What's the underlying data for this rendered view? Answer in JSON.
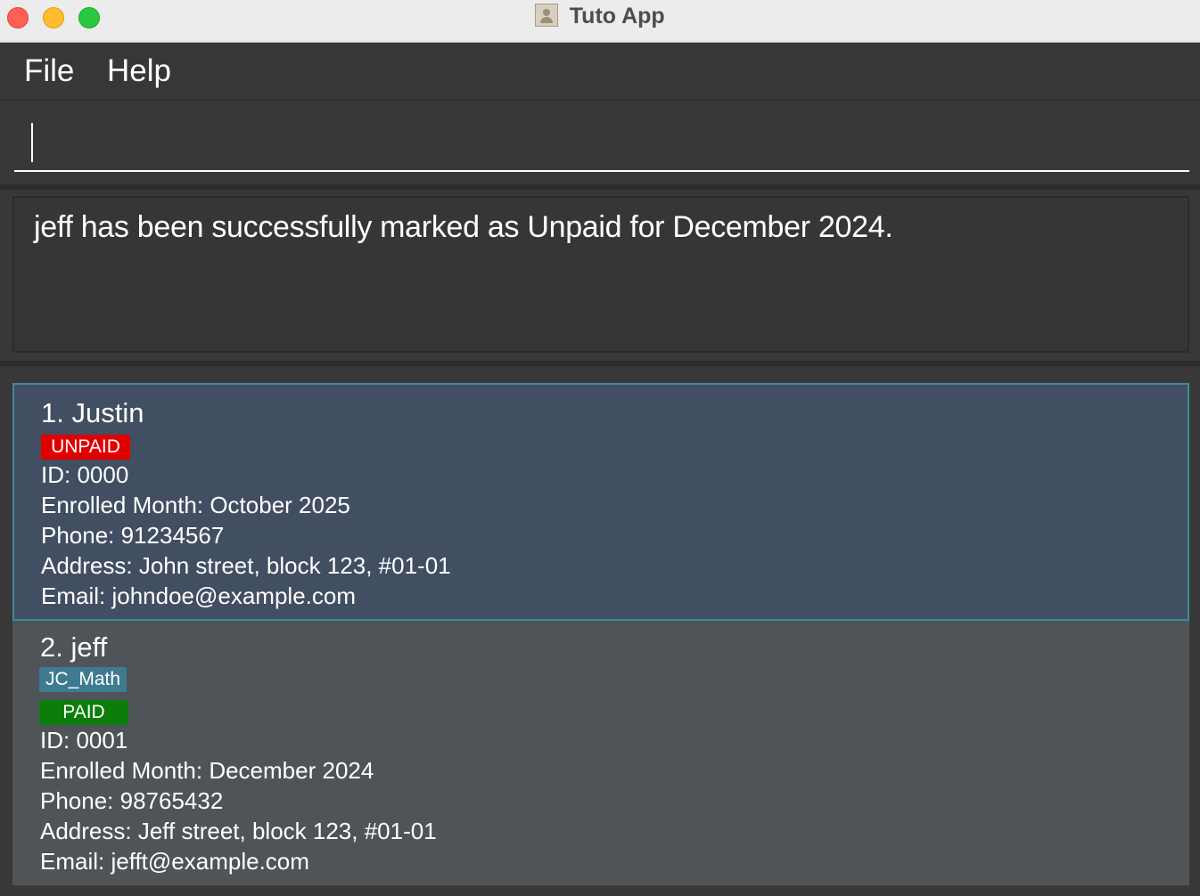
{
  "window": {
    "title": "Tuto App",
    "app_icon": "contacts-app-icon"
  },
  "menu": {
    "items": [
      "File",
      "Help"
    ]
  },
  "command": {
    "value": ""
  },
  "result": {
    "message": "jeff has been successfully marked as Unpaid for December 2024."
  },
  "persons": [
    {
      "name_line": "1. Justin",
      "tags": [],
      "payment_status": "UNPAID",
      "id_line": "ID: 0000",
      "enrolled_line": "Enrolled Month: October 2025",
      "phone_line": "Phone: 91234567",
      "address_line": "Address: John street, block 123, #01-01",
      "email_line": "Email: johndoe@example.com"
    },
    {
      "name_line": "2. jeff",
      "tags": [
        "JC_Math"
      ],
      "payment_status": "PAID",
      "id_line": "ID: 0001",
      "enrolled_line": "Enrolled Month: December 2024",
      "phone_line": "Phone: 98765432",
      "address_line": "Address: Jeff street, block 123, #01-01",
      "email_line": "Email: jefft@example.com"
    }
  ],
  "colors": {
    "unpaid": "#e00000",
    "paid": "#0b7d0b",
    "tag": "#3e7b91",
    "selected_card": "#424e61",
    "selected_border": "#3e8b9e",
    "card": "#4f5458",
    "background": "#383838"
  }
}
